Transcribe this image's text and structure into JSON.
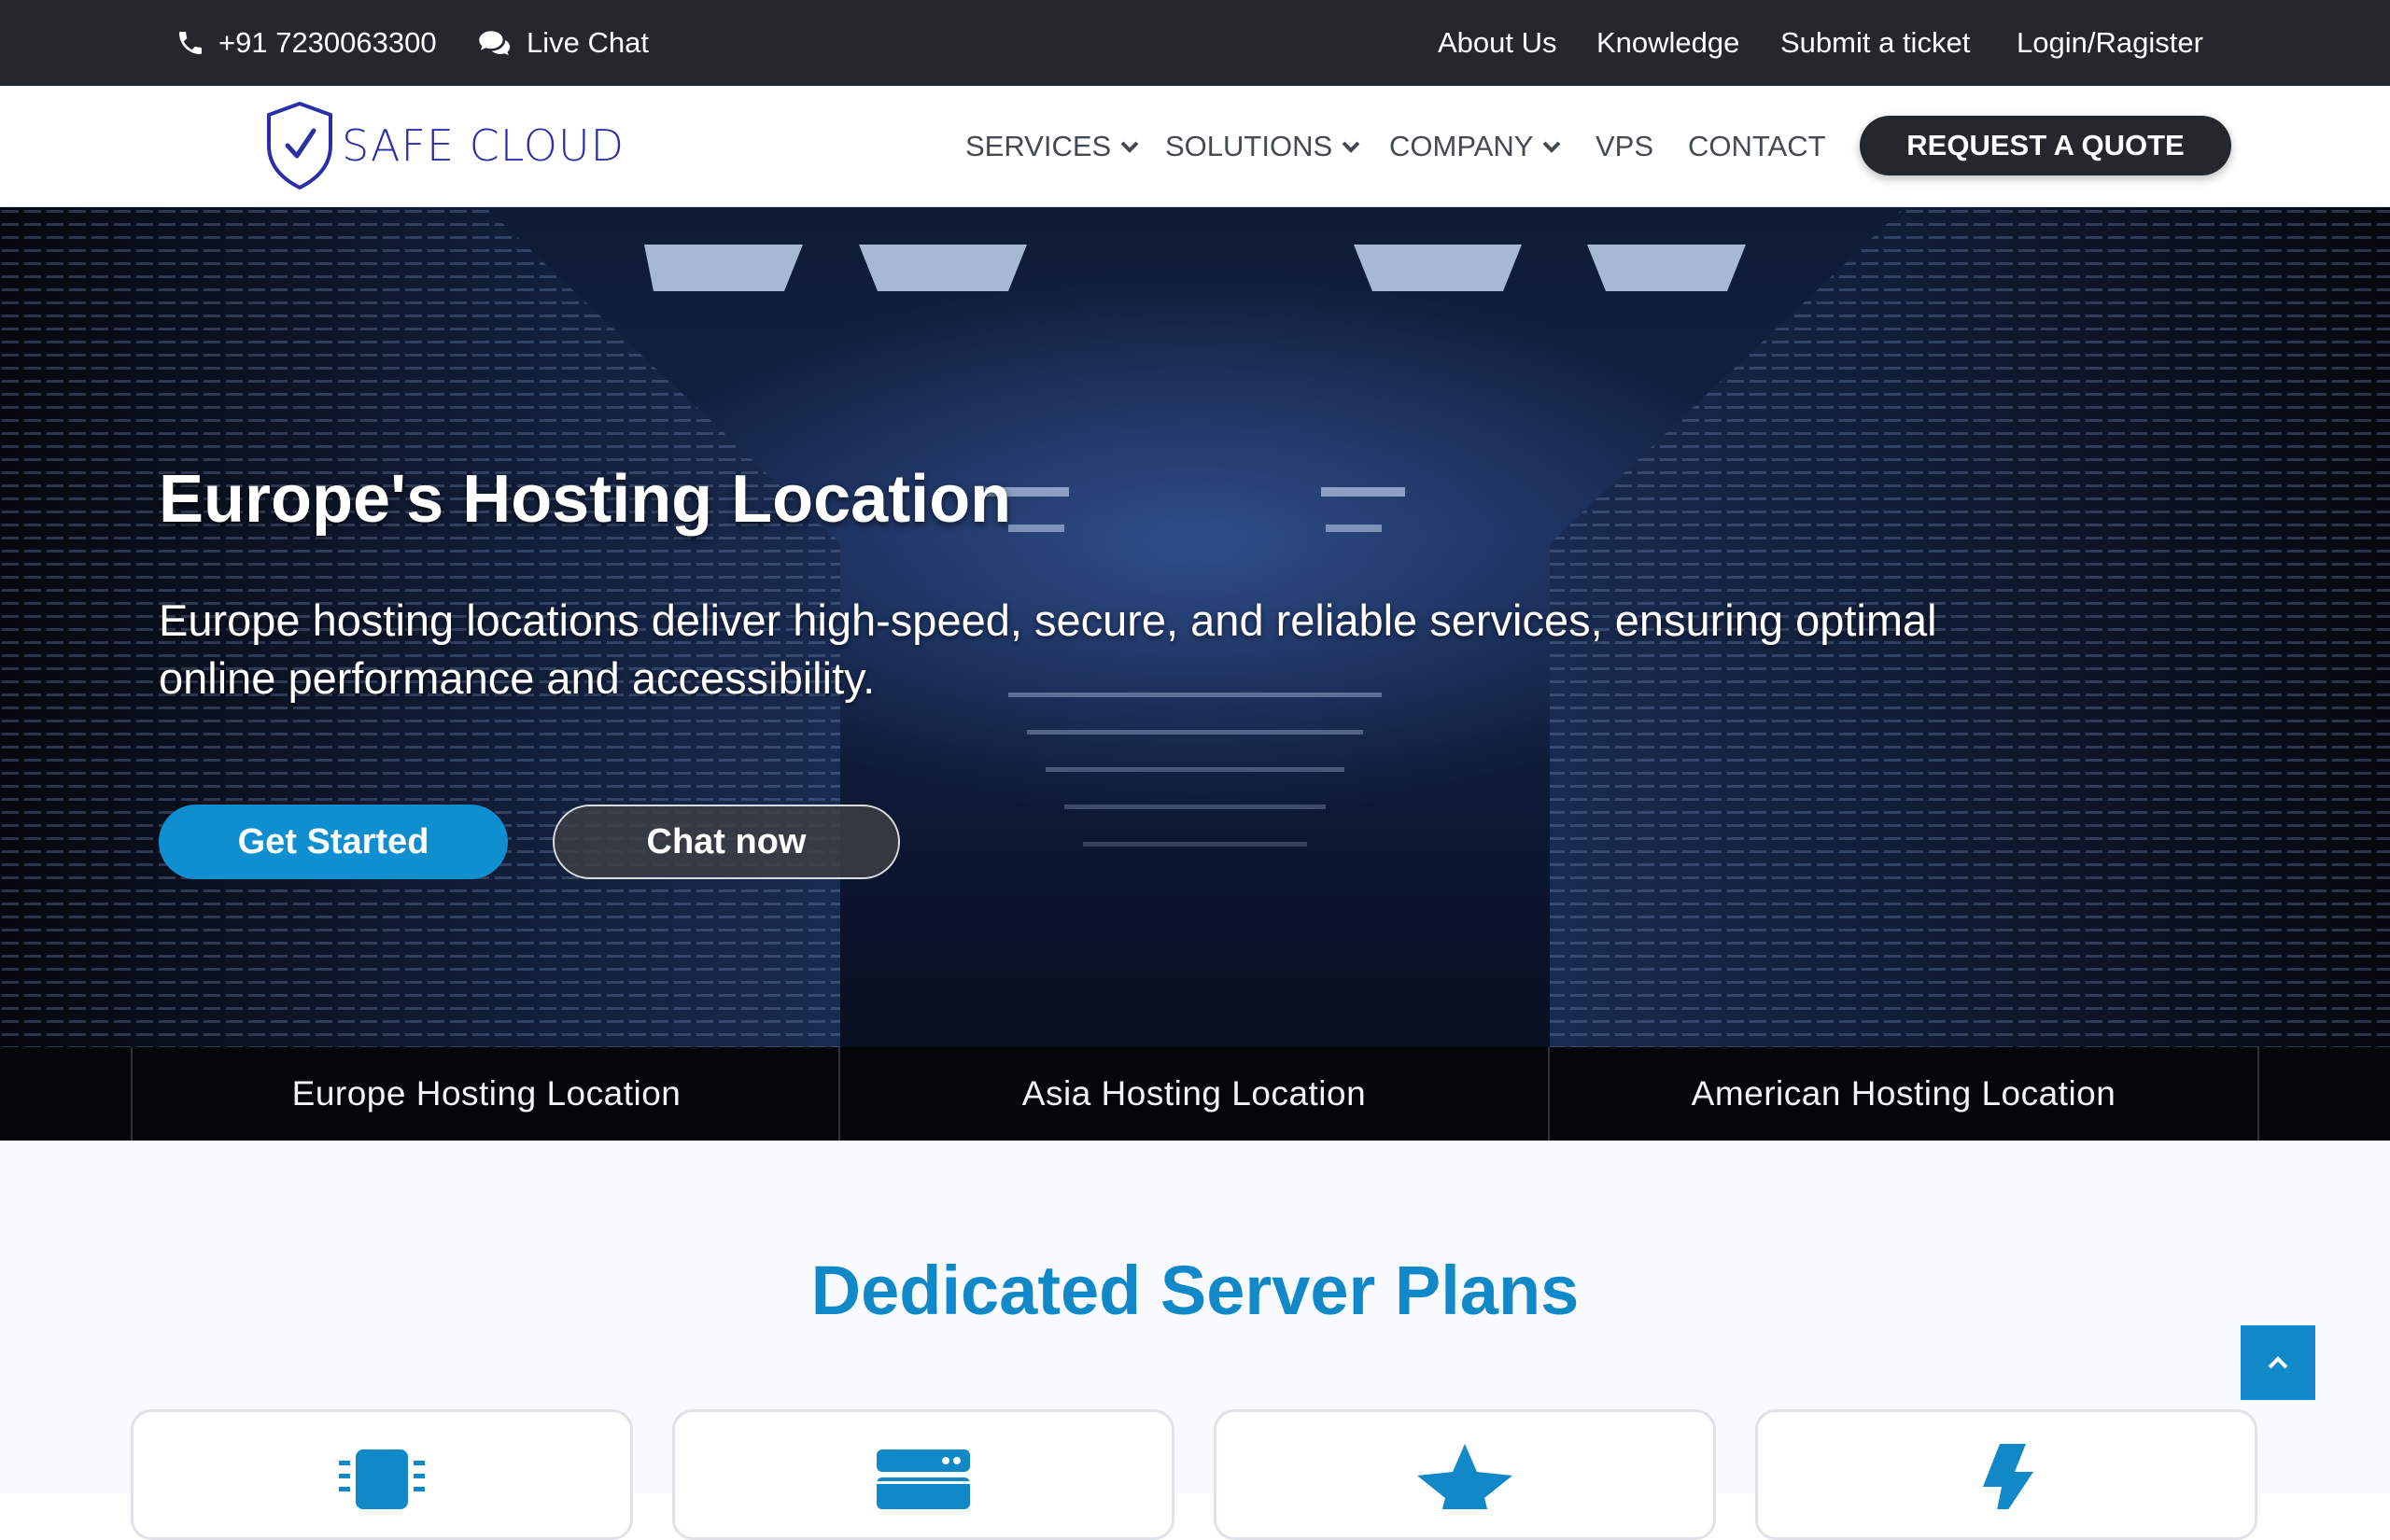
{
  "topbar": {
    "phone": "+91 7230063300",
    "live_chat": "Live Chat",
    "links": [
      "About Us",
      "Knowledge",
      "Submit a ticket",
      "Login/Ragister"
    ]
  },
  "nav": {
    "logo_text": "SAFE CLOUD",
    "items": [
      "SERVICES",
      "SOLUTIONS",
      "COMPANY",
      "VPS",
      "CONTACT"
    ],
    "quote_button": "REQUEST A QUOTE"
  },
  "hero": {
    "title": "Europe's Hosting Location",
    "subtitle": "Europe hosting locations deliver high-speed, secure, and reliable services, ensuring optimal online performance and accessibility.",
    "primary_button": "Get Started",
    "secondary_button": "Chat now"
  },
  "locations": [
    "Europe Hosting Location",
    "Asia Hosting Location",
    "American Hosting Location"
  ],
  "plans": {
    "title": "Dedicated Server Plans",
    "card_icons": [
      "cpu-icon",
      "server-icon",
      "star-icon",
      "bolt-icon"
    ]
  },
  "colors": {
    "accent": "#1189c9",
    "dark": "#24272c",
    "logo": "#2a2fa8"
  }
}
